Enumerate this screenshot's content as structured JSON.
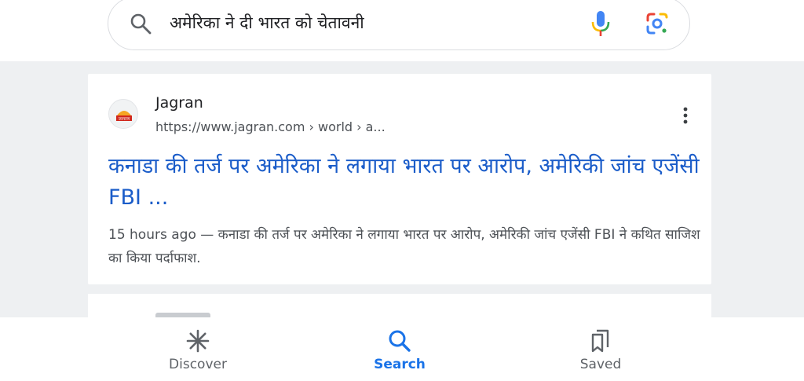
{
  "search": {
    "query": "अमेरिका ने दी भारत को चेतावनी"
  },
  "result": {
    "source_name": "Jagran",
    "source_logo_text": "जागरण",
    "url": "https://www.jagran.com › world › a...",
    "title": "कनाडा की तर्ज पर अमेरिका ने लगाया भारत पर आरोप, अमेरिकी जांच एजेंसी FBI ...",
    "time": "15 hours ago",
    "snippet": " — कनाडा की तर्ज पर अमेरिका ने लगाया भारत पर आरोप, अमेरिकी जांच एजेंसी FBI ने कथित साजिश का किया पर्दाफाश."
  },
  "bottom_nav": {
    "items": [
      {
        "label": "Discover",
        "icon": "asterisk-icon"
      },
      {
        "label": "Search",
        "icon": "search-icon"
      },
      {
        "label": "Saved",
        "icon": "bookmarks-icon"
      }
    ],
    "active_index": 1
  },
  "colors": {
    "link_blue": "#1a5cc9",
    "active_blue": "#1a73e8",
    "mic_blue": "#4285f4",
    "mic_red": "#ea4335",
    "mic_yellow": "#fbbc04",
    "mic_green": "#34a853"
  }
}
